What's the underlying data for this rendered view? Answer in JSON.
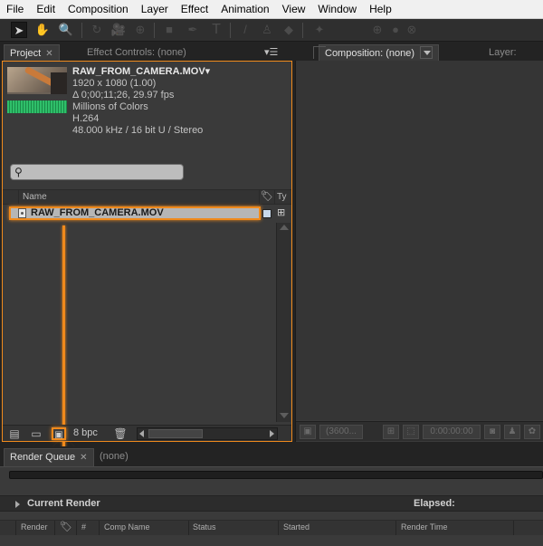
{
  "menu": [
    "File",
    "Edit",
    "Composition",
    "Layer",
    "Effect",
    "Animation",
    "View",
    "Window",
    "Help"
  ],
  "toolbar": {
    "tools": [
      "selection-tool",
      "hand-tool",
      "zoom-tool",
      "rotate-tool",
      "camera-tool",
      "pan-behind-tool",
      "rectangle-tool",
      "pen-tool",
      "type-tool",
      "brush-tool",
      "clone-stamp-tool",
      "eraser-tool",
      "puppet-pin-tool"
    ],
    "glyphs": [
      "➤",
      "✋",
      "🔍",
      "↻",
      "🎥",
      "⊕",
      "■",
      "✒",
      "T",
      "/",
      "♙",
      "◆",
      "✦",
      "⊕",
      "●",
      "⊗"
    ]
  },
  "project": {
    "tab_label": "Project",
    "effect_tab": "Effect Controls: (none)",
    "file": {
      "name": "RAW_FROM_CAMERA.MOV",
      "name_suffix": "▾",
      "resolution": "1920 x 1080 (1.00)",
      "duration": "Δ 0;00;11;26, 29.97 fps",
      "colors": "Millions of Colors",
      "codec": "H.264",
      "audio": "48.000 kHz / 16 bit U / Stereo"
    },
    "search_glyph": "⚲",
    "column_name": "Name",
    "column_tag_icon": "🏷",
    "column_type": "Ty",
    "item": "RAW_FROM_CAMERA.MOV",
    "bpc": "8 bpc",
    "bottom_icons": [
      "interpret-footage-icon",
      "new-folder-icon",
      "new-composition-icon",
      "trash-icon"
    ]
  },
  "composition": {
    "tab_label": "Composition: (none)",
    "layer_tab": "Layer: (none",
    "zoom": "(3600...",
    "timecode": "0:00:00:00"
  },
  "render_queue": {
    "tab_label": "Render Queue",
    "none_tab": "(none)",
    "current_render": "Current Render",
    "elapsed": "Elapsed:",
    "columns": [
      "Render",
      "#",
      "Comp Name",
      "Status",
      "Started",
      "Render Time"
    ]
  },
  "colors": {
    "highlight": "#f08a1c",
    "panel": "#3a3a3a",
    "background": "#232323"
  }
}
